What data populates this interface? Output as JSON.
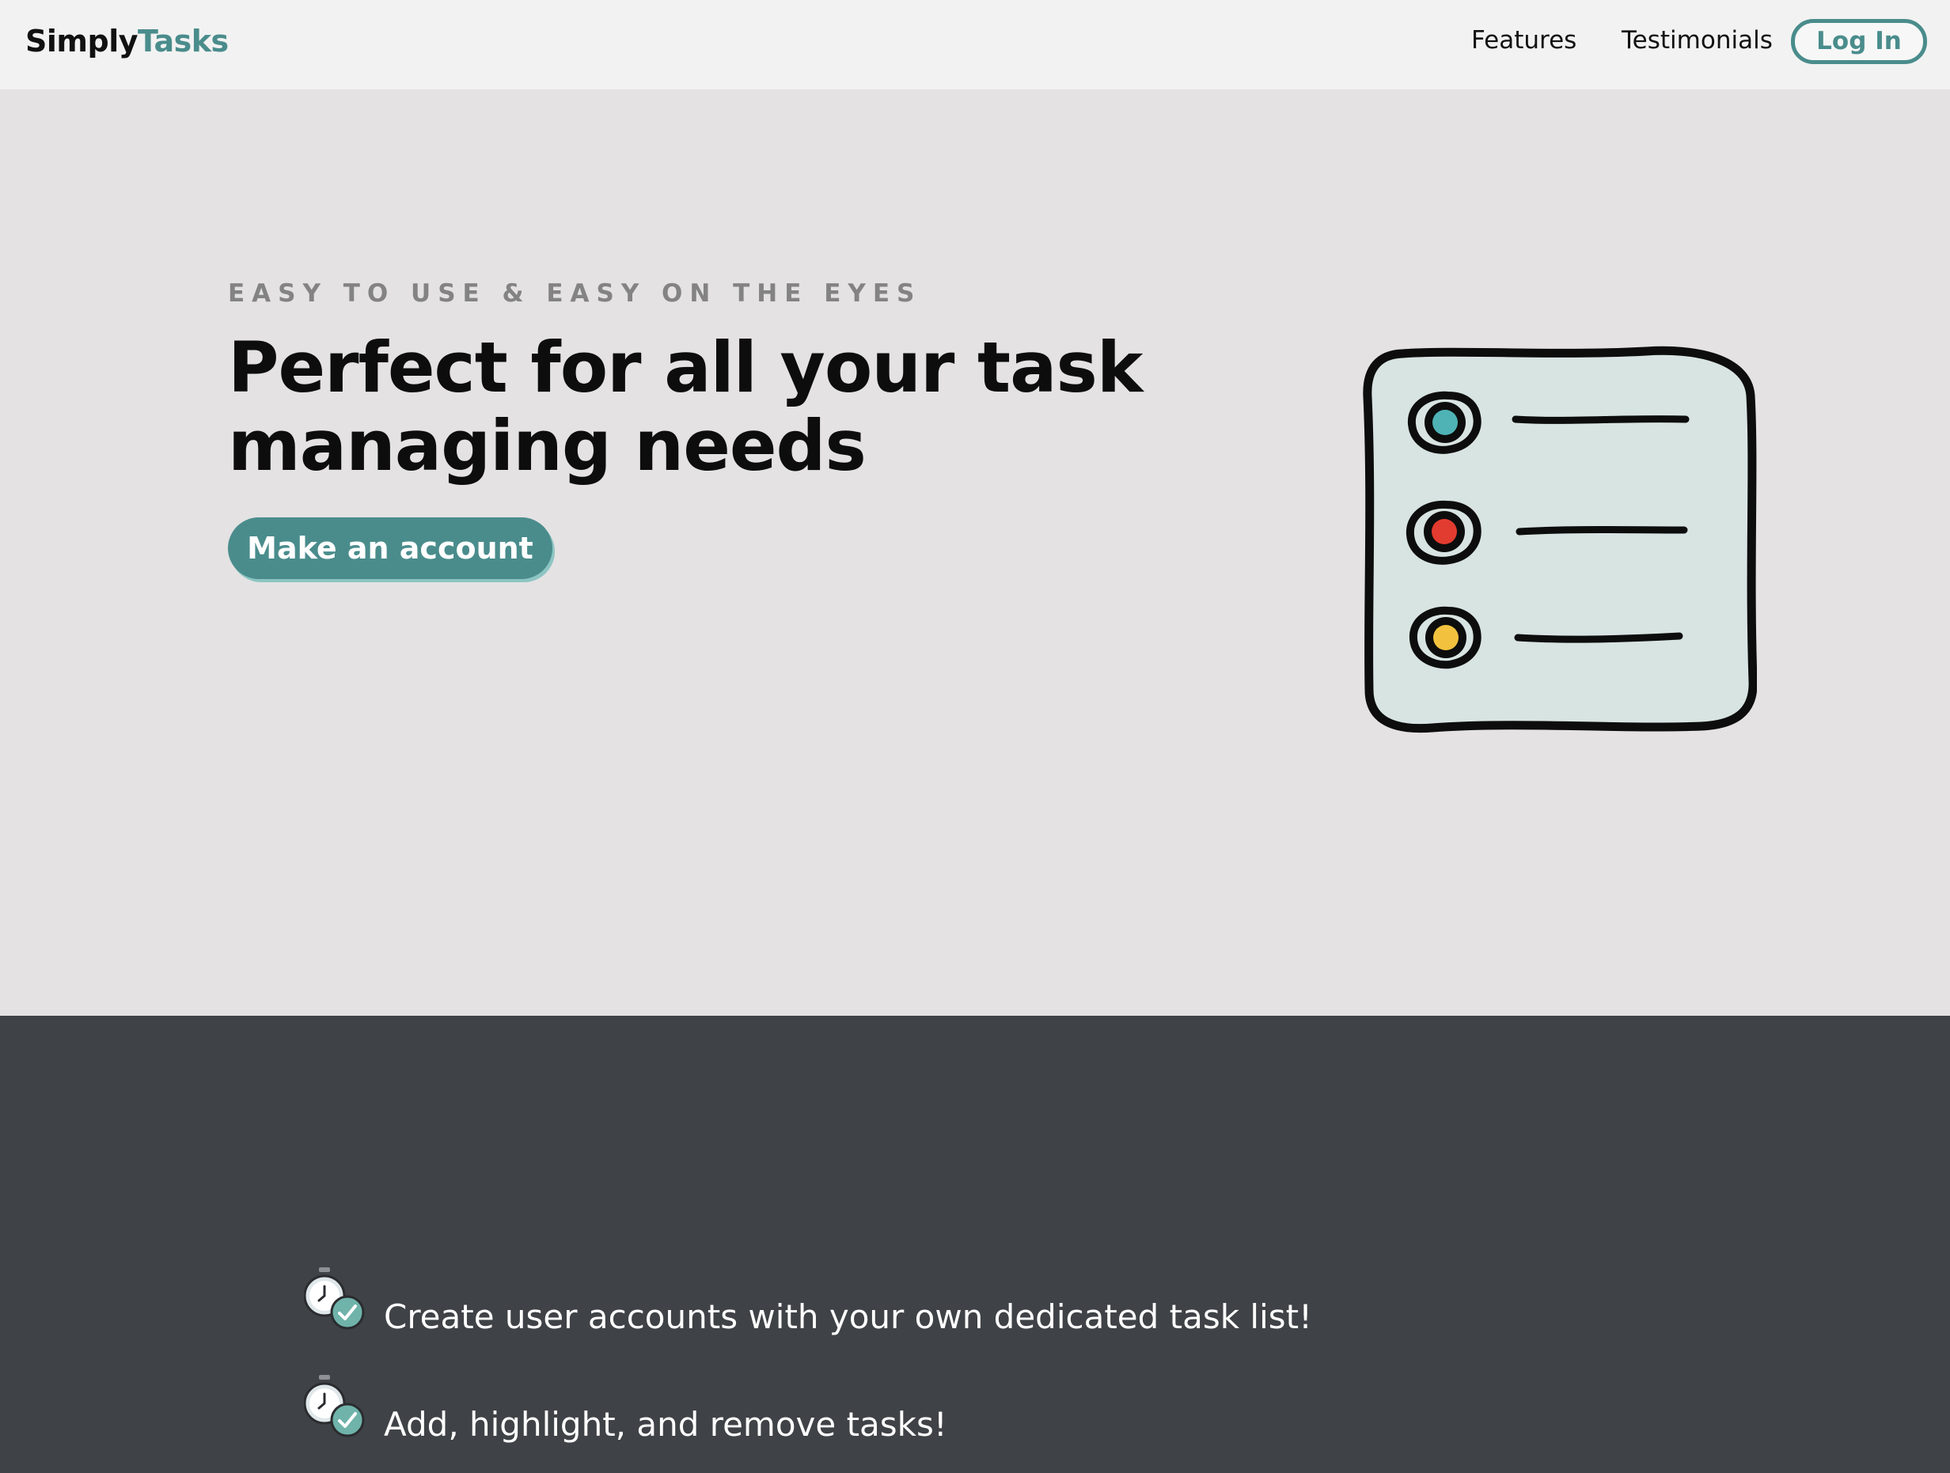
{
  "nav": {
    "logo_primary": "Simply",
    "logo_accent": "Tasks",
    "links": [
      "Features",
      "Testimonials"
    ],
    "login_label": "Log In"
  },
  "hero": {
    "eyebrow": "EASY TO USE & EASY ON THE EYES",
    "headline_line1": "Perfect for all your task",
    "headline_line2": "managing needs",
    "cta_label": "Make an account",
    "illustration_icon": "task-list-illustration",
    "dot_colors": [
      "#4fb3b6",
      "#e23b2f",
      "#f2c23e"
    ]
  },
  "features": {
    "items": [
      {
        "icon": "stopwatch-check-icon",
        "text": "Create user accounts with your own dedicated task list!"
      },
      {
        "icon": "stopwatch-check-icon",
        "text": "Add, highlight, and remove tasks!"
      }
    ]
  },
  "colors": {
    "brand_teal": "#4a8c8c",
    "nav_bg": "#f2f2f2",
    "hero_bg": "#e4e2e3",
    "features_bg": "#3f4246"
  }
}
